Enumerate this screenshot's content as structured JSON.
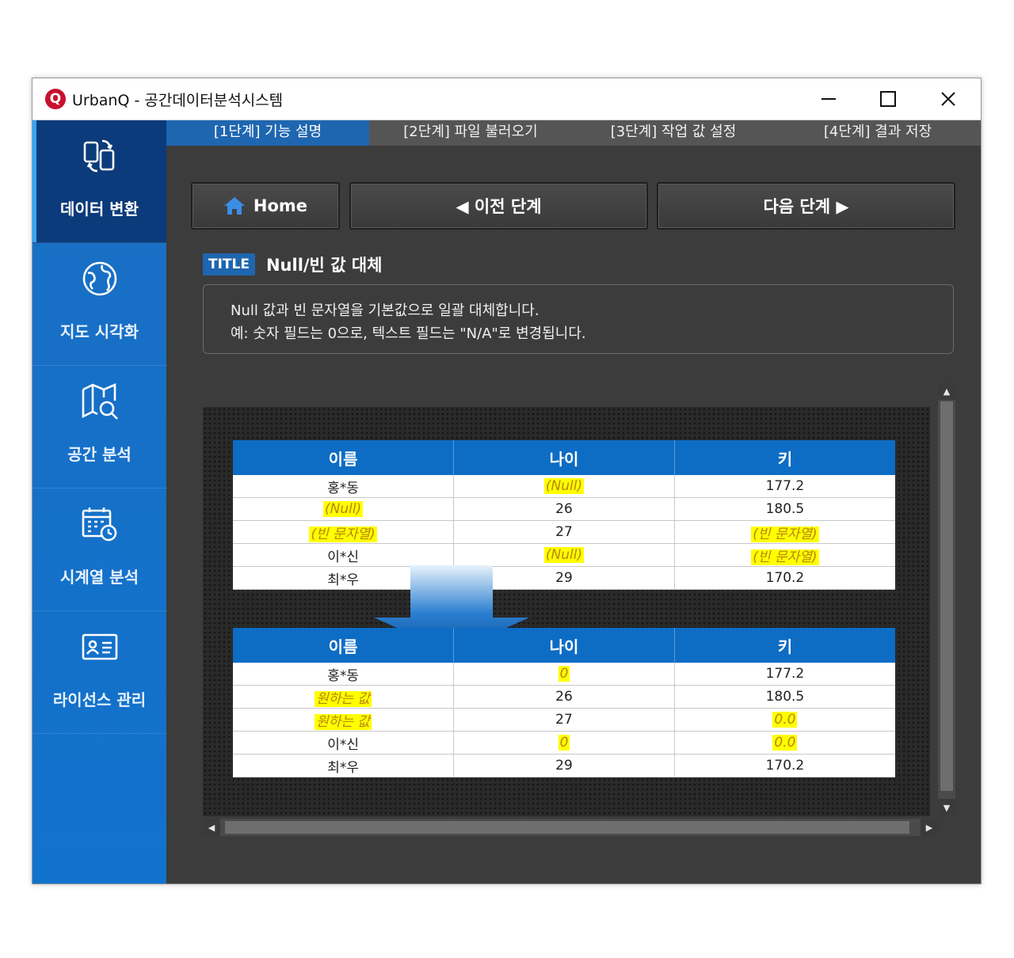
{
  "window": {
    "title": "UrbanQ - 공간데이터분석시스템",
    "logo_letter": "Q"
  },
  "sidebar": {
    "items": [
      {
        "label": "데이터 변환",
        "icon": "data-convert-icon",
        "active": true
      },
      {
        "label": "지도 시각화",
        "icon": "globe-icon",
        "active": false
      },
      {
        "label": "공간 분석",
        "icon": "map-search-icon",
        "active": false
      },
      {
        "label": "시계열 분석",
        "icon": "calendar-clock-icon",
        "active": false
      },
      {
        "label": "라이선스 관리",
        "icon": "id-card-icon",
        "active": false
      }
    ]
  },
  "tabs": [
    {
      "label": "[1단계] 기능 설명",
      "active": true
    },
    {
      "label": "[2단계] 파일 불러오기",
      "active": false
    },
    {
      "label": "[3단계] 작업 값 설정",
      "active": false
    },
    {
      "label": "[4단계] 결과 저장",
      "active": false
    }
  ],
  "nav": {
    "home_label": "Home",
    "prev_label": "◀ 이전 단계",
    "next_label": "다음 단계 ▶"
  },
  "section": {
    "badge": "TITLE",
    "title": "Null/빈 값 대체",
    "desc_line1": "Null 값과 빈 문자열을 기본값으로 일괄 대체합니다.",
    "desc_line2": "예: 숫자 필드는 0으로, 텍스트 필드는 \"N/A\"로 변경됩니다."
  },
  "before_table": {
    "headers": [
      "이름",
      "나이",
      "키"
    ],
    "rows": [
      [
        "홍*동",
        "(Null)",
        "177.2"
      ],
      [
        "(Null)",
        "26",
        "180.5"
      ],
      [
        "(빈 문자열)",
        "27",
        "(빈 문자열)"
      ],
      [
        "이*신",
        "(Null)",
        "(빈 문자열)"
      ],
      [
        "최*우",
        "29",
        "170.2"
      ]
    ]
  },
  "after_table": {
    "headers": [
      "이름",
      "나이",
      "키"
    ],
    "rows": [
      [
        "홍*동",
        "0",
        "177.2"
      ],
      [
        "원하는 값",
        "26",
        "180.5"
      ],
      [
        "원하는 값",
        "27",
        "0.0"
      ],
      [
        "이*신",
        "0",
        "0.0"
      ],
      [
        "최*우",
        "29",
        "170.2"
      ]
    ]
  },
  "colors": {
    "accent": "#1f66b0",
    "sidebar": "#1172cc",
    "sidebar_active": "#0b3b7a",
    "highlight": "#ffff00"
  }
}
